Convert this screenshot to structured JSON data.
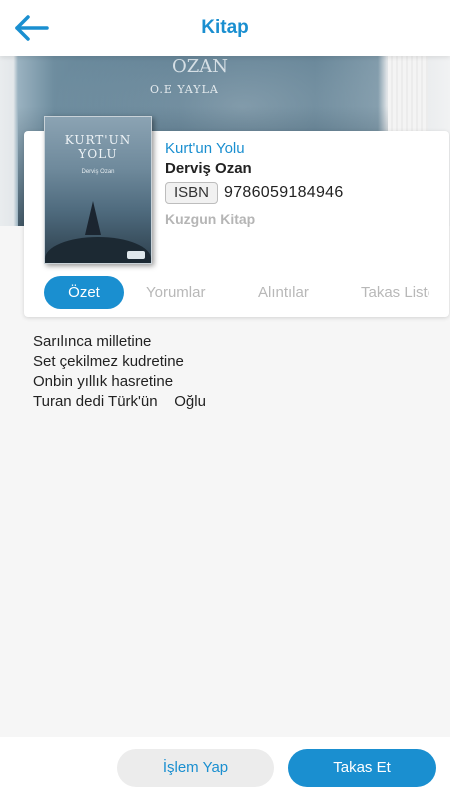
{
  "header": {
    "title": "Kitap",
    "back_icon": "arrow-left-icon"
  },
  "banner": {
    "text_line1": "OZAN",
    "text_line2": "O.E YAYLA"
  },
  "cover": {
    "title": "KURT'UN YOLU",
    "author": "Derviş Ozan"
  },
  "book": {
    "title": "Kurt'un Yolu",
    "author": "Derviş Ozan",
    "isbn_label": "ISBN",
    "isbn": "9786059184946",
    "publisher": "Kuzgun Kitap"
  },
  "tabs": [
    {
      "label": "Özet",
      "active": true
    },
    {
      "label": "Yorumlar",
      "active": false
    },
    {
      "label": "Alıntılar",
      "active": false
    },
    {
      "label": "Takas Listesi",
      "active": false
    }
  ],
  "summary_lines": [
    "Sarılınca milletine",
    "Set çekilmez kudretine",
    "Onbin yıllık hasretine",
    "Turan dedi Türk'ün    Oğlu"
  ],
  "actions": {
    "secondary_label": "İşlem Yap",
    "primary_label": "Takas Et"
  },
  "colors": {
    "accent": "#1a8fd0",
    "muted_text": "#b8b8b8"
  }
}
